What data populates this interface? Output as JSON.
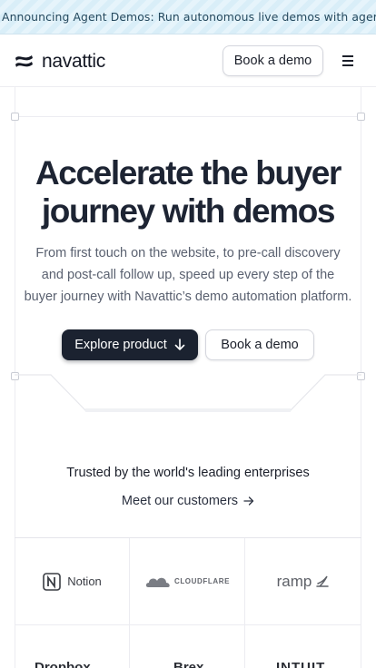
{
  "announcement": {
    "text": "Announcing Agent Demos: Run autonomous live demos with agents"
  },
  "header": {
    "brand": "navattic",
    "book_demo_label": "Book a demo",
    "menu_icon": "hamburger-menu-icon"
  },
  "hero": {
    "title_line1": "Accelerate the buyer",
    "title_line2": "journey with demos",
    "subtitle_line1": "From first touch on the website, to pre-call discovery",
    "subtitle_line2": "and post-call follow up, speed up every step of the",
    "subtitle_line3": "buyer journey with Navattic’s demo automation platform.",
    "primary_cta": "Explore product",
    "secondary_cta": "Book a demo"
  },
  "customers": {
    "heading": "Trusted by the world's leading enterprises",
    "link": "Meet our customers",
    "logos": [
      "Notion",
      "CLOUDFLARE",
      "ramp",
      "Dropbox",
      "Brex",
      "INTUIT"
    ]
  },
  "colors": {
    "primary_button": "#1b2230",
    "announcement_bg": "#d9eef8",
    "text_dark": "#1d2433",
    "text_muted": "#5a6170"
  }
}
